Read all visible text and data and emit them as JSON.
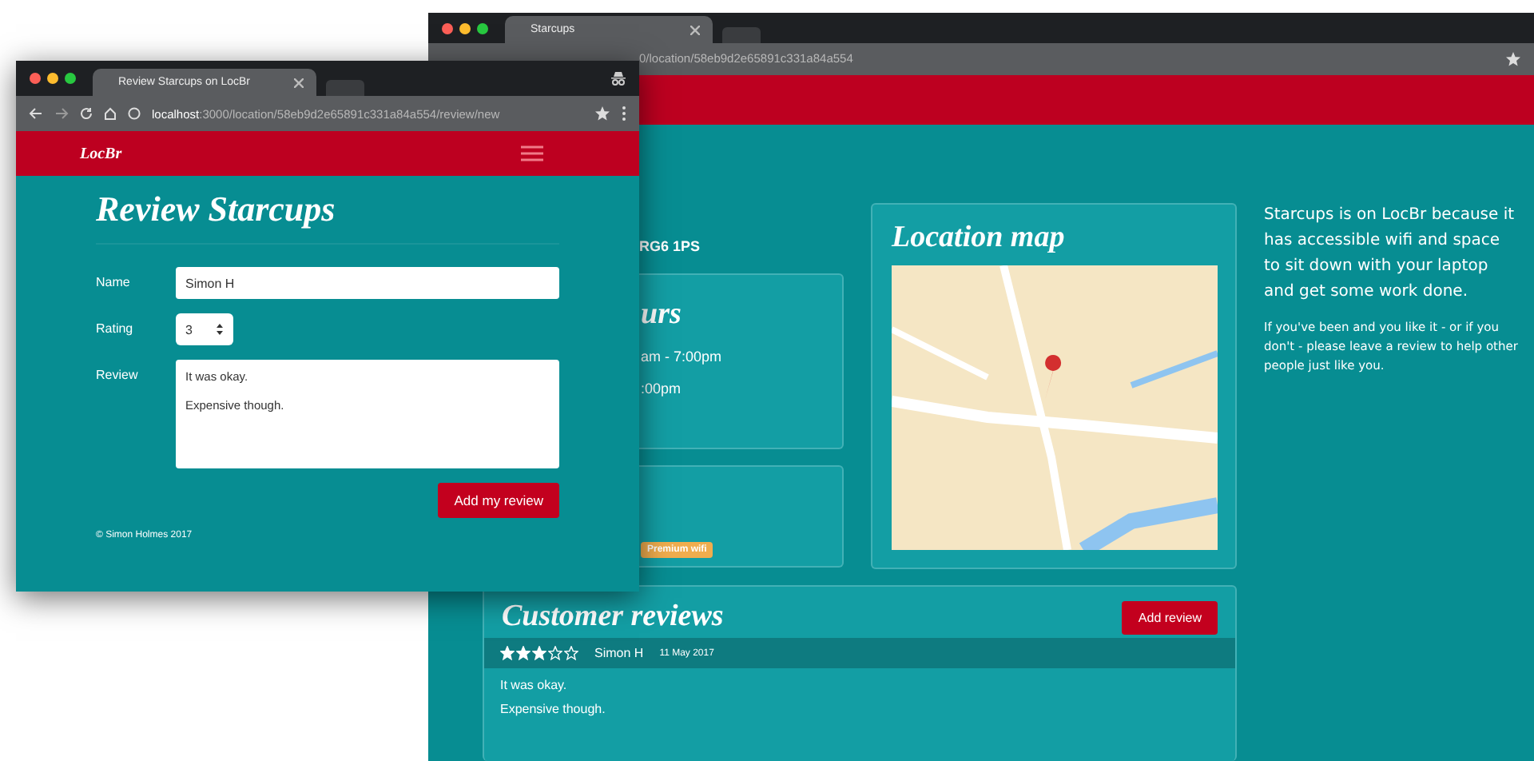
{
  "back_window": {
    "tab_title": "Starcups",
    "address": "0/location/58eb9d2e65891c331a84a554",
    "address_line": "RG6 1PS",
    "hours": {
      "title": "urs",
      "lines": [
        "am - 7:00pm",
        ":00pm"
      ]
    },
    "facilities": {
      "tags": [
        "Premium wifi"
      ]
    },
    "map_panel": {
      "title": "Location map"
    },
    "sidebar": {
      "lead": "Starcups is on LocBr because it has accessible wifi and space to sit down with your laptop and get some work done.",
      "note": "If you've been and you like it - or if you don't - please leave a review to help other people just like you."
    },
    "reviews": {
      "title": "Customer reviews",
      "add_button": "Add review",
      "items": [
        {
          "stars": 3,
          "author": "Simon H",
          "date": "11 May 2017",
          "lines": [
            "It was okay.",
            "Expensive though."
          ]
        }
      ]
    }
  },
  "front_window": {
    "tab_title": "Review Starcups on LocBr",
    "address_host": "localhost",
    "address_path": ":3000/location/58eb9d2e65891c331a84a554/review/new",
    "brand": "LocBr",
    "heading": "Review Starcups",
    "form": {
      "name_label": "Name",
      "name_value": "Simon H",
      "rating_label": "Rating",
      "rating_value": "3",
      "review_label": "Review",
      "review_value": "It was okay.\n\nExpensive though."
    },
    "submit": "Add my review",
    "footer": "© Simon Holmes 2017"
  }
}
